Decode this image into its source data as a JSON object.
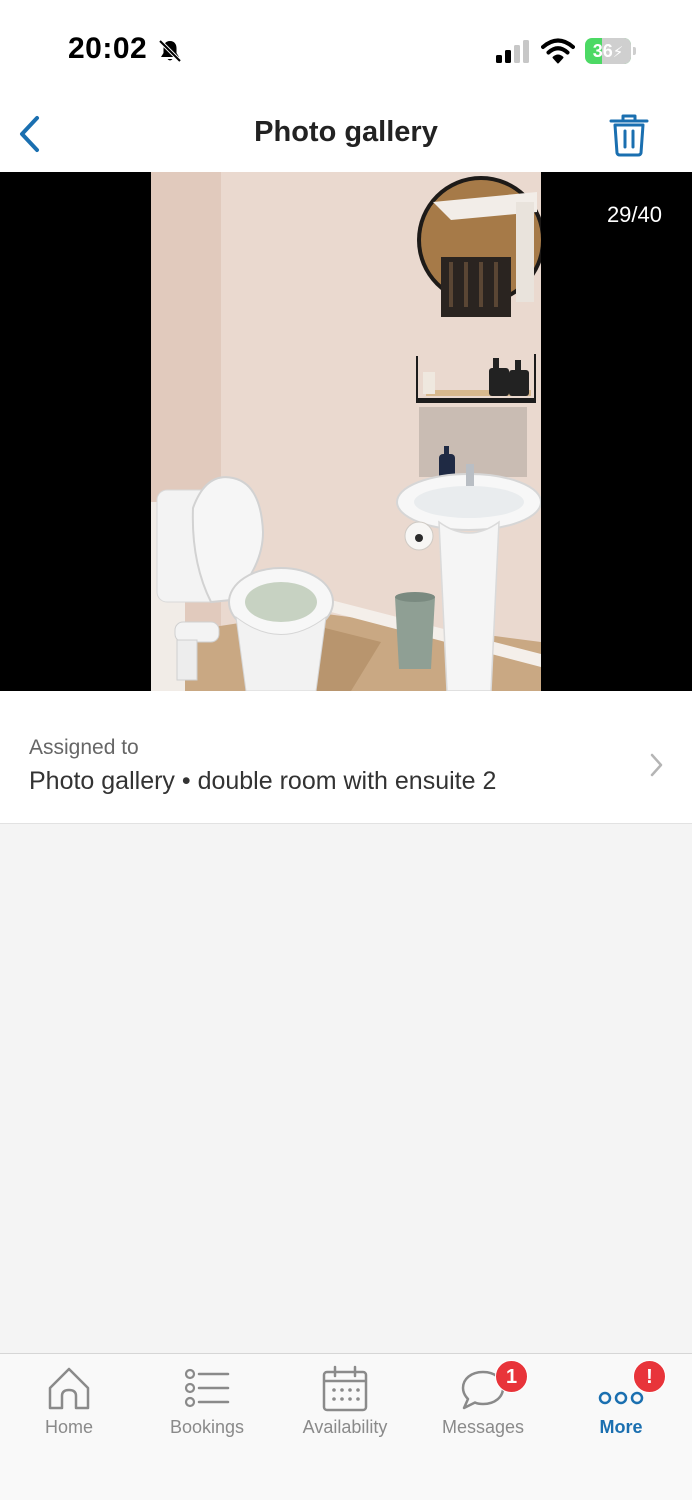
{
  "status_bar": {
    "time": "20:02",
    "battery_level": "36",
    "battery_fraction": 0.36,
    "icons": [
      "bell-slash-icon",
      "cellular-signal-icon",
      "wifi-icon",
      "battery-charging-icon"
    ]
  },
  "header": {
    "title": "Photo gallery",
    "back_icon": "chevron-left-icon",
    "action_icon": "trash-icon",
    "accent_color": "#1a6fb0"
  },
  "viewer": {
    "counter": "29/40",
    "photo_subject": "bathroom"
  },
  "assigned": {
    "label": "Assigned to",
    "value": "Photo gallery • double room with ensuite 2",
    "chevron_icon": "chevron-right-icon"
  },
  "tab_bar": {
    "active_color": "#1a6fb0",
    "inactive_color": "#8a8a8a",
    "badge_color": "#e8343a",
    "tabs": [
      {
        "label": "Home",
        "icon": "home-icon",
        "active": false
      },
      {
        "label": "Bookings",
        "icon": "list-icon",
        "active": false
      },
      {
        "label": "Availability",
        "icon": "calendar-icon",
        "active": false
      },
      {
        "label": "Messages",
        "icon": "chat-bubble-icon",
        "active": false,
        "badge": "1"
      },
      {
        "label": "More",
        "icon": "more-dots-icon",
        "active": true,
        "badge": "!"
      }
    ]
  }
}
